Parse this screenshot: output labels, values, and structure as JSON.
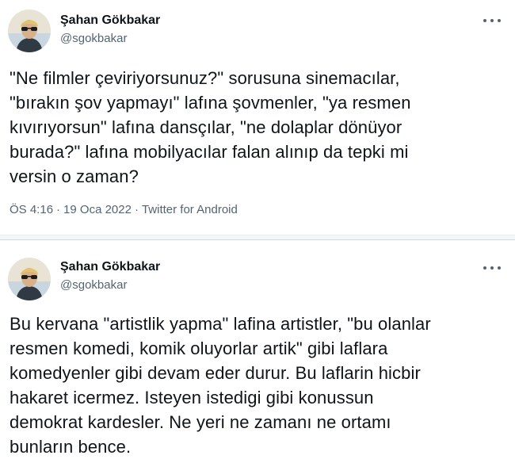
{
  "tweets": [
    {
      "author": {
        "display_name": "Şahan Gökbakar",
        "handle": "@sgokbakar",
        "avatar_icon": "profile-photo"
      },
      "text": "\"Ne filmler çeviriyorsunuz?\" sorusuna sinemacılar,\n\"bırakın şov yapmayı\" lafına şovmenler, \"ya resmen\nkıvırıyorsun\" lafına dansçılar, \"ne dolaplar dönüyor\nburada?\" lafına mobilyacılar falan alınıp da tepki mi\nversin o zaman?",
      "time": "ÖS 4:16",
      "date": "19 Oca 2022",
      "source": "Twitter for Android",
      "more_icon": "more-horizontal-icon"
    },
    {
      "author": {
        "display_name": "Şahan Gökbakar",
        "handle": "@sgokbakar",
        "avatar_icon": "profile-photo"
      },
      "text": "Bu kervana \"artistlik yapma\" lafina artistler, \"bu olanlar\nresmen komedi, komik oluyorlar artik\" gibi laflara\nkomedyenler gibi devam eder durur. Bu laflarin hicbir\nhakaret icermez. Isteyen istedigi gibi konussun\ndemokrat kardesler. Ne yeri ne zamanı ne ortamı\nbunların bence.",
      "more_icon": "more-horizontal-icon"
    }
  ],
  "colors": {
    "text_primary": "#0f1419",
    "text_secondary": "#536471",
    "divider": "#cfd9de",
    "background": "#ffffff"
  }
}
